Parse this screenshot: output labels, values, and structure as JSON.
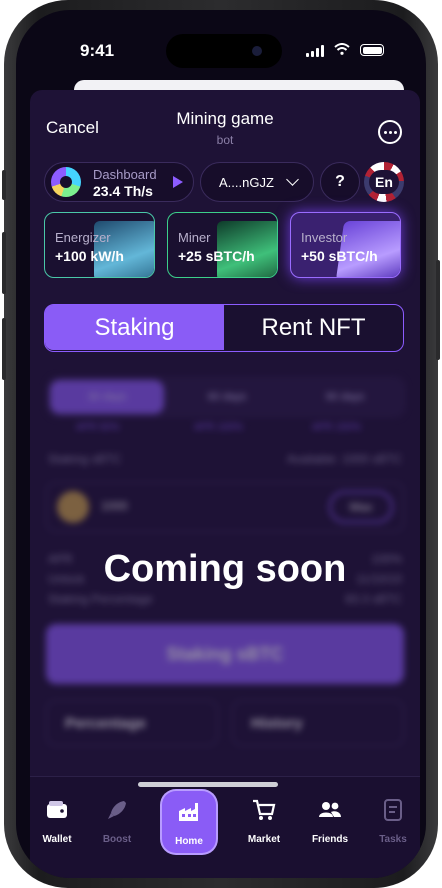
{
  "status_bar": {
    "time": "9:41"
  },
  "header": {
    "cancel_label": "Cancel",
    "title": "Mining game",
    "subtitle": "bot",
    "more_icon": "more-icon"
  },
  "dashboard": {
    "label": "Dashboard",
    "value": "23.4 Th/s"
  },
  "wallet_address": "A....nGJZ",
  "help_label": "?",
  "language": "En",
  "cards": [
    {
      "label": "Energizer",
      "value": "+100 kW/h"
    },
    {
      "label": "Miner",
      "value": "+25 sBTC/h"
    },
    {
      "label": "Investor",
      "value": "+50 sBTC/h"
    }
  ],
  "segmented": {
    "staking": "Staking",
    "rent_nft": "Rent NFT",
    "selected": "Staking"
  },
  "blurred_content": {
    "periods": [
      "30 days",
      "60 days",
      "90 days"
    ],
    "aprs": [
      "APR 50%",
      "APR 100%",
      "APR 150%"
    ],
    "staking_label": "Staking sBTC",
    "available": "Available: 1000 sBTC",
    "amount": "1000",
    "max_label": "Max",
    "rows": [
      {
        "label": "APR",
        "value": "100%"
      },
      {
        "label": "Unlock",
        "value": "11/10/10"
      },
      {
        "label": "Staking Percentage",
        "value": "83.3 sBTC"
      }
    ],
    "stake_button": "Staking sBTC",
    "percentage_button": "Percentage",
    "history_button": "History"
  },
  "overlay": {
    "coming_soon": "Coming soon"
  },
  "tabbar": [
    {
      "label": "Wallet",
      "icon": "wallet-icon"
    },
    {
      "label": "Boost",
      "icon": "rocket-icon"
    },
    {
      "label": "Home",
      "icon": "factory-icon"
    },
    {
      "label": "Market",
      "icon": "cart-icon"
    },
    {
      "label": "Friends",
      "icon": "friends-icon"
    },
    {
      "label": "Tasks",
      "icon": "tasks-icon"
    }
  ],
  "colors": {
    "accent": "#8a5cf6",
    "background": "#1e1236",
    "tabbar": "#1a0f30"
  }
}
